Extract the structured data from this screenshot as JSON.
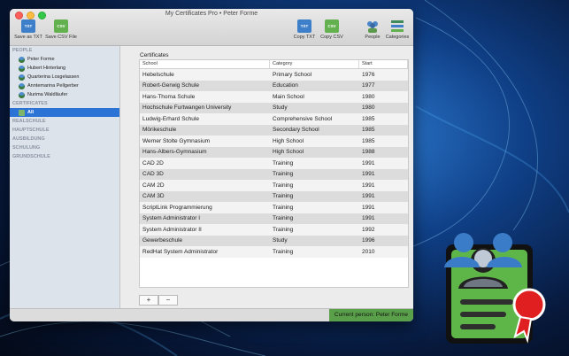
{
  "window": {
    "title": "My Certificates Pro • Peter Forme"
  },
  "toolbar": {
    "left": [
      {
        "label": "Save as TXT",
        "icon": "txt-file-icon",
        "badge": "TXT",
        "color": "#3d7fc9"
      },
      {
        "label": "Save CSV File",
        "icon": "csv-file-icon",
        "badge": "CSV",
        "color": "#62b14e"
      }
    ],
    "right": [
      {
        "label": "Copy TXT",
        "icon": "copy-txt-icon",
        "badge": "TXT",
        "color": "#3d7fc9"
      },
      {
        "label": "Copy CSV",
        "icon": "copy-csv-icon",
        "badge": "CSV",
        "color": "#62b14e"
      },
      {
        "label": "People",
        "icon": "people-icon",
        "color": "#4a86c8"
      },
      {
        "label": "Categories",
        "icon": "categories-icon",
        "color": "#3d8b5a"
      }
    ]
  },
  "sidebar": {
    "people_header": "PEOPLE",
    "people": [
      "Peter Forme",
      "Hubert Hinterlang",
      "Quarterina Losgelassen",
      "Anntemarina Pellgerber",
      "Nurima Waldläufer"
    ],
    "certificates_header": "CERTIFICATES",
    "selected_category": "All",
    "categories": [
      "REALSCHULE",
      "HAUPTSCHULE",
      "AUSBILDUNG",
      "SCHULUNG",
      "GRUNDSCHULE"
    ]
  },
  "main": {
    "label": "Certificates",
    "columns": [
      "School",
      "Category",
      "Start"
    ],
    "rows": [
      [
        "Hebelschule",
        "Primary School",
        "1976"
      ],
      [
        "Robert-Gerwig Schule",
        "Education",
        "1977"
      ],
      [
        "Hans-Thoma Schule",
        "Main School",
        "1980"
      ],
      [
        "Hochschule Furtwangen University",
        "Study",
        "1980"
      ],
      [
        "Ludwig-Erhard Schule",
        "Comprehensive School",
        "1985"
      ],
      [
        "Mörikeschule",
        "Secondary School",
        "1985"
      ],
      [
        "Werner Stolte Gymnasium",
        "High School",
        "1985"
      ],
      [
        "Hans-Albers-Gymnasium",
        "High School",
        "1988"
      ],
      [
        "CAD 2D",
        "Training",
        "1991"
      ],
      [
        "CAD 3D",
        "Training",
        "1991"
      ],
      [
        "CAM 2D",
        "Training",
        "1991"
      ],
      [
        "CAM 3D",
        "Training",
        "1991"
      ],
      [
        "ScriptLink Programmierung",
        "Training",
        "1991"
      ],
      [
        "System Administrator I",
        "Training",
        "1991"
      ],
      [
        "System Administrator II",
        "Training",
        "1992"
      ],
      [
        "Gewerbeschule",
        "Study",
        "1996"
      ],
      [
        "RedHat System Administrator",
        "Training",
        "2010"
      ]
    ],
    "add_label": "+",
    "remove_label": "−"
  },
  "status": {
    "text": "Current person: Peter Forme",
    "color": "#5aa04a"
  }
}
